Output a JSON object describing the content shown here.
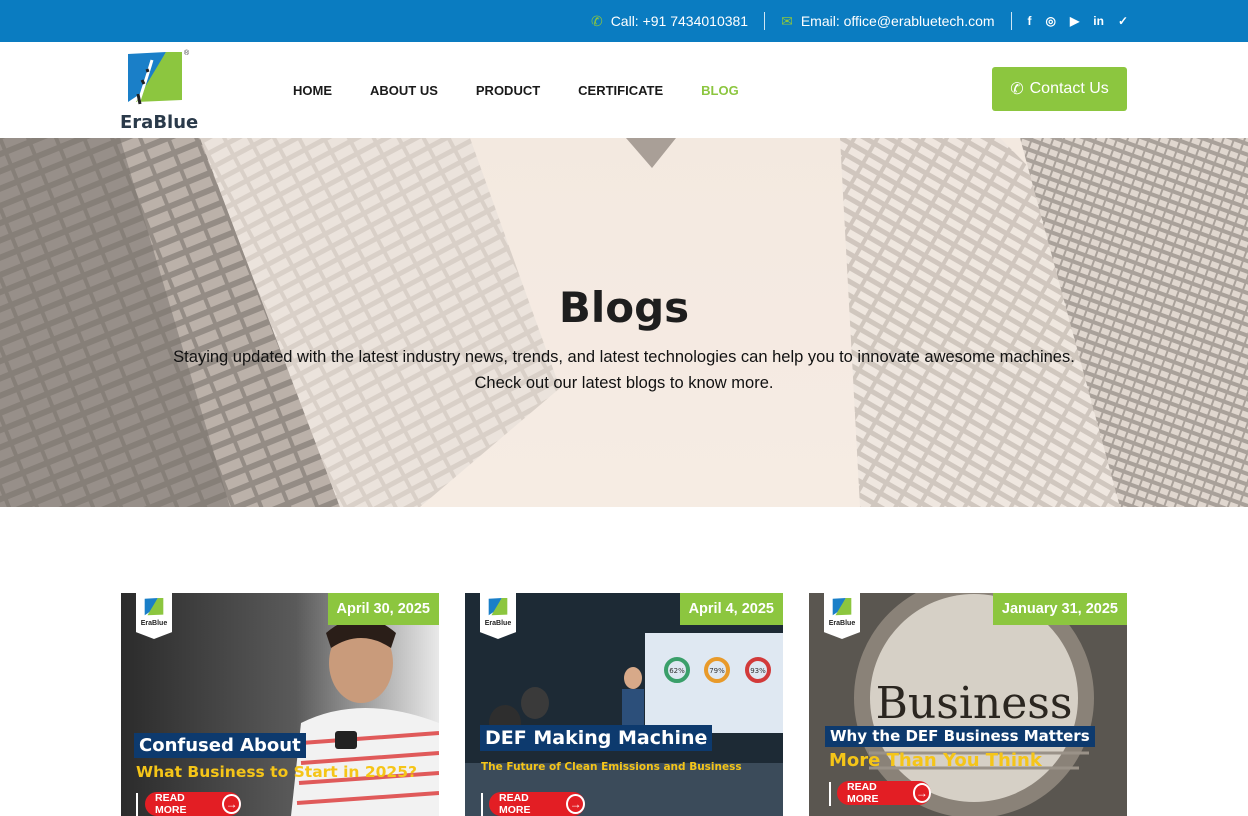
{
  "topbar": {
    "call_label": "Call: +91 7434010381",
    "email_label": "Email: office@erabluetech.com",
    "socials": [
      "facebook-icon",
      "instagram-icon",
      "youtube-icon",
      "linkedin-icon",
      "twitter-icon"
    ],
    "social_glyphs": [
      "f",
      "◎",
      "▶",
      "in",
      "✓"
    ]
  },
  "brand": {
    "name": "EraBlue",
    "reg": "®"
  },
  "nav": {
    "items": [
      "HOME",
      "ABOUT US",
      "PRODUCT",
      "CERTIFICATE",
      "BLOG"
    ],
    "active": "BLOG"
  },
  "cta": {
    "label": "Contact Us"
  },
  "hero": {
    "title": "Blogs",
    "subtitle_line1": "Staying updated with the latest industry news, trends, and latest technologies can help you to innovate awesome machines.",
    "subtitle_line2": "Check out our latest blogs to know more."
  },
  "cards": [
    {
      "date": "April 30, 2025",
      "badge": "EraBlue",
      "title1": "Confused About",
      "title2": "What Business to Start in 2025?",
      "read_more": "READ MORE"
    },
    {
      "date": "April 4, 2025",
      "badge": "EraBlue",
      "title1": "DEF Making Machine",
      "title2": "The Future of Clean Emissions and Business",
      "read_more": "READ MORE",
      "screen_stats": [
        "62%",
        "79%",
        "93%"
      ]
    },
    {
      "date": "January 31, 2025",
      "badge": "EraBlue",
      "title1": "Why the DEF Business Matters",
      "title2": "More Than You Think",
      "read_more": "READ MORE",
      "magnifier_text": "Business"
    }
  ],
  "colors": {
    "topbar": "#0a7cc1",
    "accent": "#8cc63f",
    "read_more": "#e31e24",
    "headline_bg": "#0d3a6e",
    "headline_yellow": "#f5c518"
  }
}
